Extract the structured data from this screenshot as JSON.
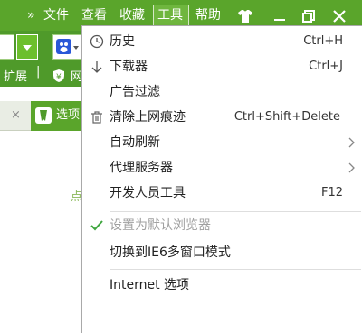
{
  "titlebar": {
    "chevron": "»",
    "menus": [
      "文件",
      "查看",
      "收藏",
      "工具",
      "帮助"
    ],
    "selected_menu": "工具"
  },
  "toolbar": {
    "ext_label": "扩展",
    "ext_item": "网"
  },
  "tabbar": {
    "tab_label": "选项"
  },
  "content": {
    "partial_text": "点"
  },
  "menu": {
    "items": [
      {
        "icon": "clock-icon",
        "label": "历史",
        "shortcut": "Ctrl+H"
      },
      {
        "icon": "download-arrow-icon",
        "label": "下载器",
        "shortcut": "Ctrl+J"
      },
      {
        "icon": "",
        "label": "广告过滤",
        "shortcut": ""
      },
      {
        "icon": "trash-icon",
        "label": "清除上网痕迹",
        "shortcut": "Ctrl+Shift+Delete"
      },
      {
        "icon": "",
        "label": "自动刷新",
        "shortcut": "",
        "submenu": true
      },
      {
        "icon": "",
        "label": "代理服务器",
        "shortcut": "",
        "submenu": true
      },
      {
        "icon": "",
        "label": "开发人员工具",
        "shortcut": "F12"
      },
      {
        "icon": "check-icon",
        "label": "设置为默认浏览器",
        "shortcut": "",
        "disabled": true
      },
      {
        "icon": "",
        "label": "切换到IE6多窗口模式",
        "shortcut": ""
      },
      {
        "icon": "",
        "label": "Internet 选项",
        "shortcut": ""
      }
    ]
  },
  "colors": {
    "brand_green": "#5aa52b",
    "check_green": "#3fa63f"
  }
}
